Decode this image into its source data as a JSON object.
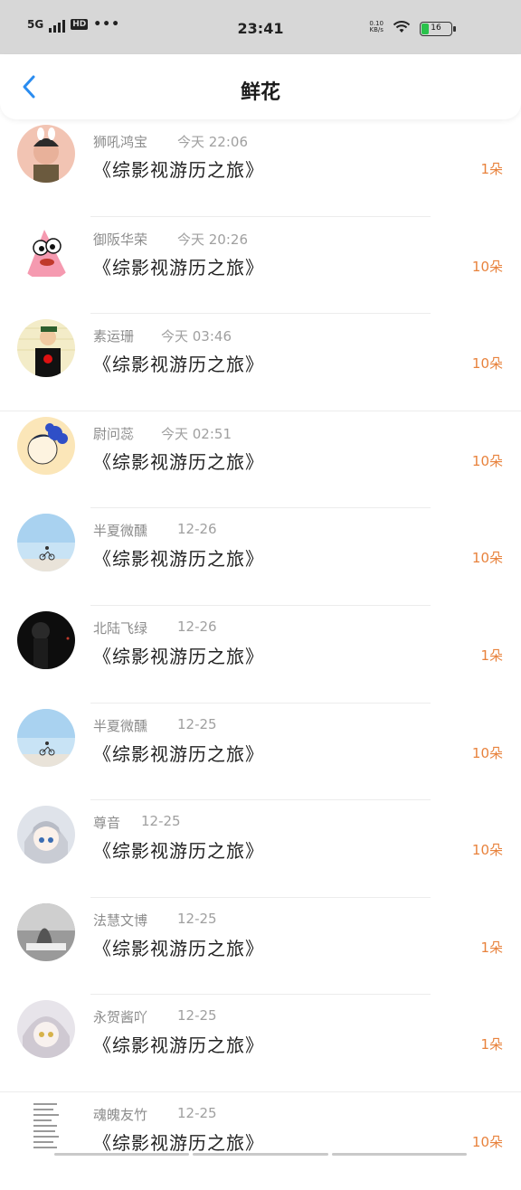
{
  "status_bar": {
    "network": "5G",
    "hd_badge": "HD",
    "more": "•••",
    "time": "23:41",
    "net_speed_value": "0.10",
    "net_speed_unit": "KB/s",
    "battery_level": "16"
  },
  "header": {
    "back_icon": "chevron-left-icon",
    "title": "鲜花"
  },
  "rows": [
    {
      "name": "狮吼鸿宝",
      "time": "今天 22:06",
      "content": "《综影视游历之旅》",
      "count": "1朵"
    },
    {
      "name": "御阪华荣",
      "time": "今天 20:26",
      "content": "《综影视游历之旅》",
      "count": "10朵"
    },
    {
      "name": "素运珊",
      "time": "今天 03:46",
      "content": "《综影视游历之旅》",
      "count": "10朵"
    },
    {
      "name": "尉问蕊",
      "time": "今天 02:51",
      "content": "《综影视游历之旅》",
      "count": "10朵"
    },
    {
      "name": "半夏微醺",
      "time": "12-26",
      "content": "《综影视游历之旅》",
      "count": "10朵"
    },
    {
      "name": "北陆飞绿",
      "time": "12-26",
      "content": "《综影视游历之旅》",
      "count": "1朵"
    },
    {
      "name": "半夏微醺",
      "time": "12-25",
      "content": "《综影视游历之旅》",
      "count": "10朵"
    },
    {
      "name": "尊音",
      "time": "12-25",
      "content": "《综影视游历之旅》",
      "count": "10朵"
    },
    {
      "name": "法慧文博",
      "time": "12-25",
      "content": "《综影视游历之旅》",
      "count": "1朵"
    },
    {
      "name": "永贺酱吖",
      "time": "12-25",
      "content": "《综影视游历之旅》",
      "count": "1朵"
    },
    {
      "name": "魂魄友竹",
      "time": "12-25",
      "content": "《综影视游历之旅》",
      "count": "10朵"
    }
  ],
  "colors": {
    "accent_blue": "#2a8cf0",
    "count_orange": "#e8823c"
  }
}
